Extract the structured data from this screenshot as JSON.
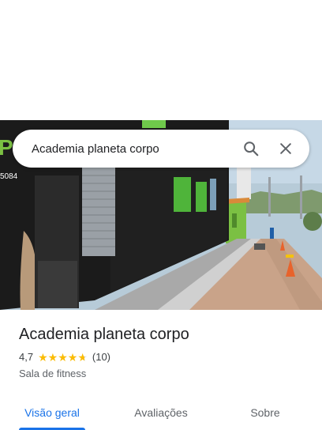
{
  "search": {
    "query": "Academia planeta corpo"
  },
  "place": {
    "name": "Academia planeta corpo",
    "rating": "4,7",
    "reviews": "(10)",
    "category": "Sala de fitness",
    "star_fill": 0.94
  },
  "tabs": [
    {
      "label": "Visão geral",
      "active": true
    },
    {
      "label": "Avaliações",
      "active": false
    },
    {
      "label": "Sobre",
      "active": false
    }
  ],
  "photo": {
    "sign_text": "PO",
    "sign_number": "5084"
  },
  "icons": [
    "search-icon",
    "close-icon",
    "star-icon"
  ],
  "colors": {
    "accent": "#1a73e8",
    "star": "#fbbc04",
    "title": "#202124"
  }
}
